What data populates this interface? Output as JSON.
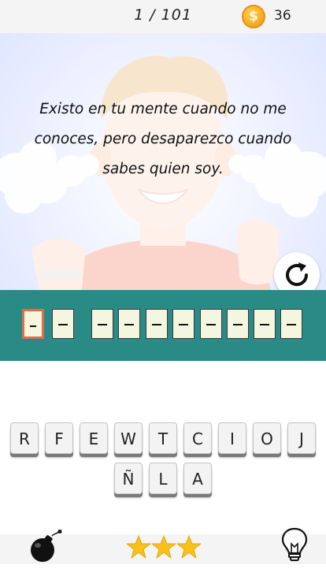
{
  "header": {
    "level_progress": "1 / 101",
    "coin_symbol": "$",
    "coin_count": "36"
  },
  "riddle": {
    "lines": [
      "Existo en tu mente cuando no me",
      "conoces, pero desaparezco cuando",
      "sabes quien soy."
    ]
  },
  "answer": {
    "word_lengths": [
      2,
      8
    ],
    "slot_placeholder": "_"
  },
  "keyboard": {
    "row1": [
      "R",
      "F",
      "E",
      "W",
      "T",
      "C",
      "I",
      "O",
      "J"
    ],
    "row2": [
      "Ñ",
      "L",
      "A"
    ]
  },
  "footer": {
    "stars_earned": 3,
    "icons": [
      "bomb-icon",
      "star-icon",
      "lightbulb-icon"
    ]
  },
  "colors": {
    "answer_band": "#2a8a86",
    "active_slot_border": "#e26b4c",
    "star": "#f6c21a",
    "coin": "#f2a21b"
  }
}
